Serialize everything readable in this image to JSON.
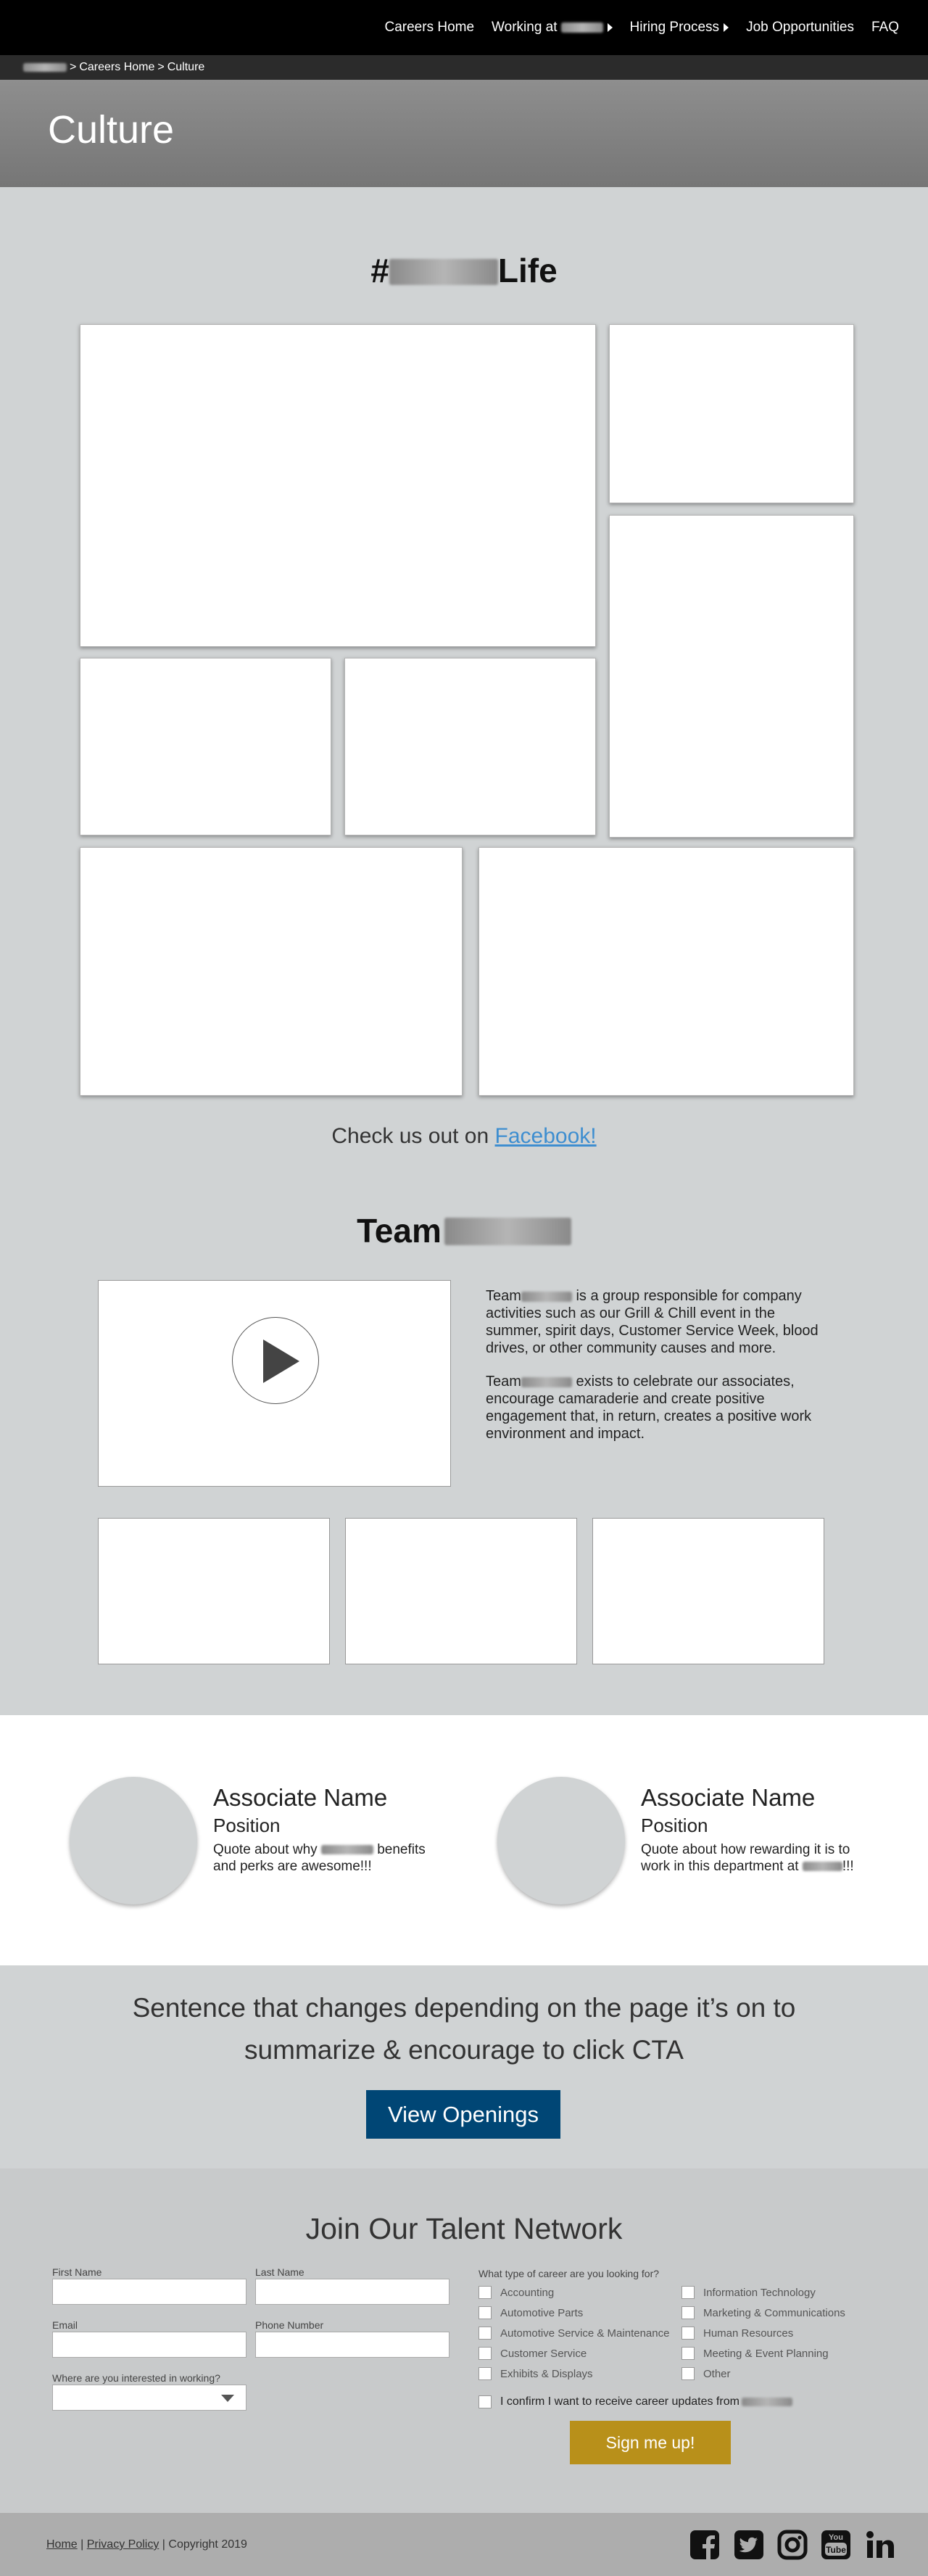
{
  "nav": {
    "links": [
      "Careers Home",
      "Working at",
      "Hiring Process",
      "Job Opportunities",
      "FAQ"
    ]
  },
  "breadcrumb": {
    "careers_home": "Careers Home",
    "separator": ">",
    "current": "Culture"
  },
  "hero": {
    "title": "Culture"
  },
  "life": {
    "hash": "#",
    "suffix": "Life"
  },
  "facebook": {
    "prefix": "Check us out on ",
    "link": "Facebook!"
  },
  "team": {
    "title": "Team",
    "p1_a": "Team",
    "p1_b": " is a group responsible for company activities such as our Grill & Chill event in the summer, spirit days, Customer Service Week, blood drives, or other community causes and more.",
    "p2_a": "Team",
    "p2_b": " exists to celebrate our associates, encourage camaraderie and create positive engagement that, in return, creates a positive work environment and impact."
  },
  "associates": [
    {
      "name": "Associate Name",
      "position": "Position",
      "quote_a": "Quote about why ",
      "quote_b": " benefits and perks are awesome!!!"
    },
    {
      "name": "Associate Name",
      "position": "Position",
      "quote_a": "Quote about how rewarding it is to work in this department at ",
      "quote_b": "!!!"
    }
  ],
  "cta": {
    "text": "Sentence that changes depending on the page it’s on to summarize & encourage to click CTA",
    "button": "View Openings"
  },
  "talent": {
    "title": "Join Our Talent Network",
    "first_name": "First Name",
    "last_name": "Last Name",
    "email": "Email",
    "phone": "Phone Number",
    "where": "Where are you interested in working?",
    "career_q": "What type of career are you looking for?",
    "careers_left": [
      "Accounting",
      "Automotive Parts",
      "Automotive Service & Maintenance",
      "Customer Service",
      "Exhibits & Displays"
    ],
    "careers_right": [
      "Information Technology",
      "Marketing & Communications",
      "Human Resources",
      "Meeting & Event Planning",
      "Other"
    ],
    "confirm": "I confirm I want to receive career updates from",
    "signup": "Sign me up!"
  },
  "footer": {
    "home": "Home",
    "privacy": "Privacy Policy",
    "copyright": "Copyright 2019",
    "sep": "|"
  },
  "social": [
    "facebook-icon",
    "twitter-icon",
    "instagram-icon",
    "youtube-icon",
    "linkedin-icon"
  ]
}
